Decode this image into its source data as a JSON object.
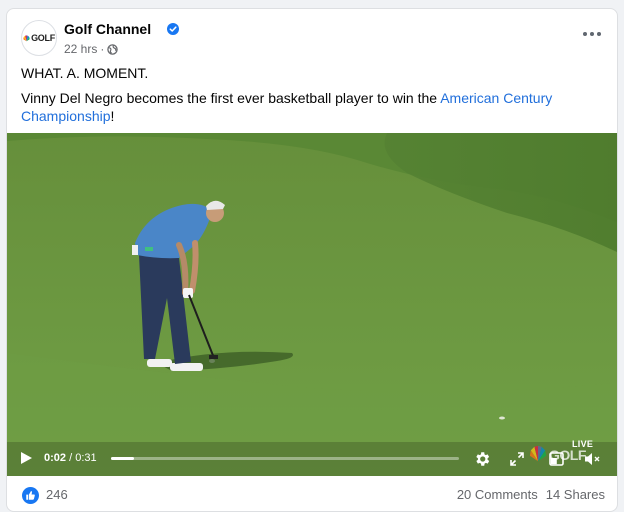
{
  "post": {
    "page_name": "Golf Channel",
    "avatar_text": "GOLF",
    "time_ago": "22 hrs",
    "separator": "·",
    "headline": "WHAT. A. MOMENT.",
    "body_prefix": "Vinny Del Negro becomes the first ever basketball player to win the ",
    "body_link": "American Century Championship",
    "body_suffix": "!"
  },
  "video": {
    "current_time": "0:02",
    "duration": "0:31",
    "time_separator": " / ",
    "progress_fraction": 0.065,
    "live_label": "LIVE",
    "watermark_text": "GOLF"
  },
  "footer": {
    "reaction_count": "246",
    "comments": "20 Comments",
    "shares": "14 Shares"
  },
  "colors": {
    "link": "#216fdb",
    "verified": "#1877f2",
    "like": "#1877f2"
  },
  "icons": [
    "verified-badge-icon",
    "globe-icon",
    "more-options-icon",
    "play-icon",
    "settings-icon",
    "fullscreen-icon",
    "pip-icon",
    "volume-muted-icon",
    "like-icon"
  ]
}
